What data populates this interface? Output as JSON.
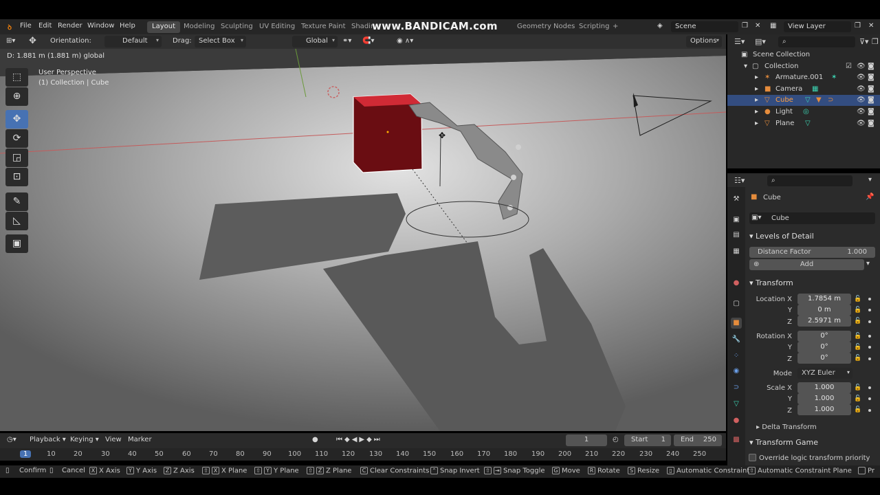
{
  "watermark": "www.BANDICAM.com",
  "menu": {
    "file": "File",
    "edit": "Edit",
    "render": "Render",
    "window": "Window",
    "help": "Help"
  },
  "workspaces": [
    "Layout",
    "Modeling",
    "Sculpting",
    "UV Editing",
    "Texture Paint",
    "Shadin",
    "Geometry Nodes",
    "Scripting",
    "+"
  ],
  "scene": {
    "name": "Scene",
    "view_layer": "View Layer"
  },
  "header": {
    "orientation_label": "Orientation:",
    "orientation_value": "Default",
    "drag_label": "Drag:",
    "drag_value": "Select Box",
    "transform_orientation": "Global",
    "options": "Options"
  },
  "viewport": {
    "status_text": "D: 1.881 m (1.881 m) global",
    "view_name": "User Perspective",
    "collection_info": "(1) Collection | Cube"
  },
  "outliner": {
    "root": "Scene Collection",
    "collection": "Collection",
    "items": [
      {
        "name": "Armature.001",
        "icon": "armature-icon"
      },
      {
        "name": "Camera",
        "icon": "camera-icon"
      },
      {
        "name": "Cube",
        "icon": "mesh-icon",
        "selected": true
      },
      {
        "name": "Light",
        "icon": "light-icon"
      },
      {
        "name": "Plane",
        "icon": "mesh-icon"
      }
    ]
  },
  "properties": {
    "object_name": "Cube",
    "data_name": "Cube",
    "lod_title": "Levels of Detail",
    "distance_factor_label": "Distance Factor",
    "distance_factor_value": "1.000",
    "add_label": "Add",
    "transform_title": "Transform",
    "location_label": "Location X",
    "y_label": "Y",
    "z_label": "Z",
    "location": [
      "1.7854 m",
      "0 m",
      "2.5971 m"
    ],
    "rotation_label": "Rotation X",
    "rotation": [
      "0°",
      "0°",
      "0°"
    ],
    "mode_label": "Mode",
    "mode_value": "XYZ Euler",
    "scale_label": "Scale X",
    "scale": [
      "1.000",
      "1.000",
      "1.000"
    ],
    "delta_transform": "Delta Transform",
    "transform_game": "Transform Game",
    "override_label": "Override logic transform priority"
  },
  "timeline": {
    "playback": "Playback",
    "keying": "Keying",
    "view": "View",
    "marker": "Marker",
    "current_frame": "1",
    "start_label": "Start",
    "start_value": "1",
    "end_label": "End",
    "end_value": "250",
    "ticks": [
      "1",
      "10",
      "20",
      "30",
      "40",
      "50",
      "60",
      "70",
      "80",
      "90",
      "100",
      "110",
      "120",
      "130",
      "140",
      "150",
      "160",
      "170",
      "180",
      "190",
      "200",
      "210",
      "220",
      "230",
      "240",
      "250"
    ]
  },
  "statusbar": [
    {
      "key": "",
      "label": "Confirm"
    },
    {
      "key": "",
      "label": "Cancel"
    },
    {
      "key": "X",
      "label": "X Axis"
    },
    {
      "key": "Y",
      "label": "Y Axis"
    },
    {
      "key": "Z",
      "label": "Z Axis"
    },
    {
      "key": "X",
      "label": "X Plane"
    },
    {
      "key": "Y",
      "label": "Y Plane"
    },
    {
      "key": "Z",
      "label": "Z Plane"
    },
    {
      "key": "C",
      "label": "Clear Constraints"
    },
    {
      "key": "",
      "label": "Snap Invert"
    },
    {
      "key": "",
      "label": "Snap Toggle"
    },
    {
      "key": "G",
      "label": "Move"
    },
    {
      "key": "R",
      "label": "Rotate"
    },
    {
      "key": "S",
      "label": "Resize"
    },
    {
      "key": "",
      "label": "Automatic Constraint"
    },
    {
      "key": "",
      "label": "Automatic Constraint Plane"
    },
    {
      "key": "",
      "label": "Pr"
    }
  ]
}
